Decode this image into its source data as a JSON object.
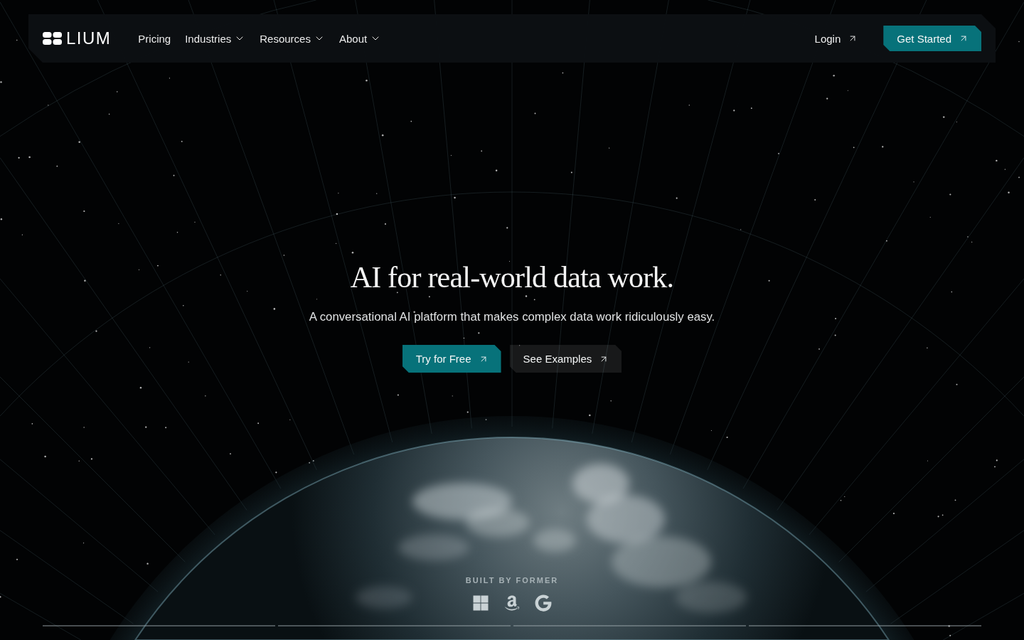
{
  "nav": {
    "logo": {
      "text": "LIUM"
    },
    "links": [
      {
        "label": "Pricing",
        "kind": "link"
      },
      {
        "label": "Industries",
        "kind": "dropdown"
      },
      {
        "label": "Resources",
        "kind": "dropdown"
      },
      {
        "label": "About",
        "kind": "dropdown"
      }
    ],
    "login": {
      "label": "Login"
    },
    "cta": {
      "label": "Get Started"
    }
  },
  "hero": {
    "title": "AI for real-world data work.",
    "subtitle": "A conversational AI platform that makes complex data work ridiculously easy.",
    "buttons": [
      {
        "label": "Try for Free",
        "kind": "primary"
      },
      {
        "label": "See Examples",
        "kind": "secondary"
      }
    ]
  },
  "built_by": {
    "label": "BUILT BY FORMER",
    "logos": [
      {
        "kind": "microsoft"
      },
      {
        "kind": "amazon"
      },
      {
        "kind": "google"
      }
    ]
  }
}
